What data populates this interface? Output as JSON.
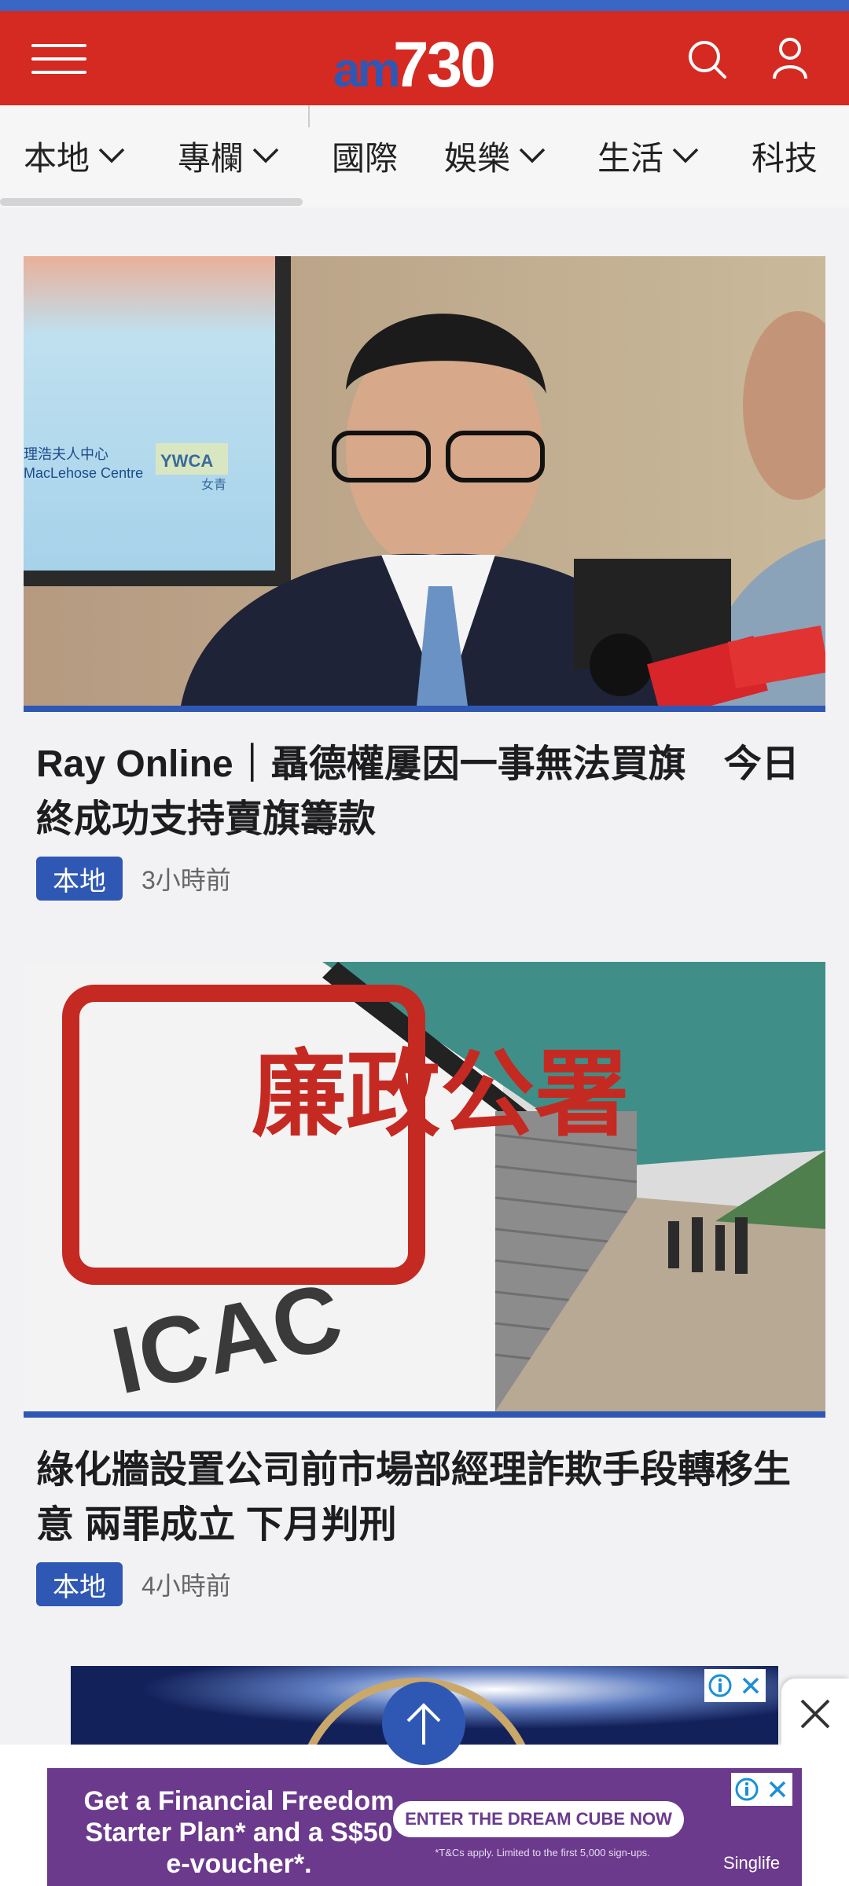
{
  "header": {
    "logo_prefix": "am",
    "logo_number": "730",
    "menu_icon": "hamburger-menu-icon",
    "search_icon": "search-icon",
    "account_icon": "user-account-icon",
    "bar_color": "#d42a22"
  },
  "nav": {
    "items": [
      {
        "label": "本地",
        "has_dropdown": true
      },
      {
        "label": "專欄",
        "has_dropdown": true
      },
      {
        "label": "國際",
        "has_dropdown": false
      },
      {
        "label": "娛樂",
        "has_dropdown": true
      },
      {
        "label": "生活",
        "has_dropdown": true
      },
      {
        "label": "科技",
        "has_dropdown": false
      }
    ]
  },
  "articles": [
    {
      "title": "Ray Online｜聶德權屢因一事無法買旗　今日終成功支持賣旗籌款",
      "category": "本地",
      "time": "3小時前",
      "image_text": {
        "centre_zh": "理浩夫人中心",
        "centre_en": "MacLehose Centre",
        "ywca": "YWCA",
        "ywca_zh": "女青"
      }
    },
    {
      "title": "綠化牆設置公司前市場部經理詐欺手段轉移生意 兩罪成立 下月判刑",
      "category": "本地",
      "time": "4小時前",
      "image_text": {
        "seal": "廉政公署",
        "logo": "ICAC"
      }
    }
  ],
  "ads": {
    "bottom": {
      "headline": "Get a Financial Freedom Starter Plan* and a S$50 e-voucher*.",
      "cta": "ENTER THE DREAM CUBE NOW",
      "fine_print": "*T&Cs apply. Limited to the first 5,000 sign-ups.",
      "brand": "Singlife"
    },
    "adchoices_icon": "adchoices-info-icon",
    "close_icon": "close-icon"
  },
  "scroll_top_icon": "arrow-up-icon",
  "colors": {
    "accent_blue": "#2f58b4",
    "top_stripe": "#3a66c4",
    "ad_purple": "#6b3a8d"
  }
}
